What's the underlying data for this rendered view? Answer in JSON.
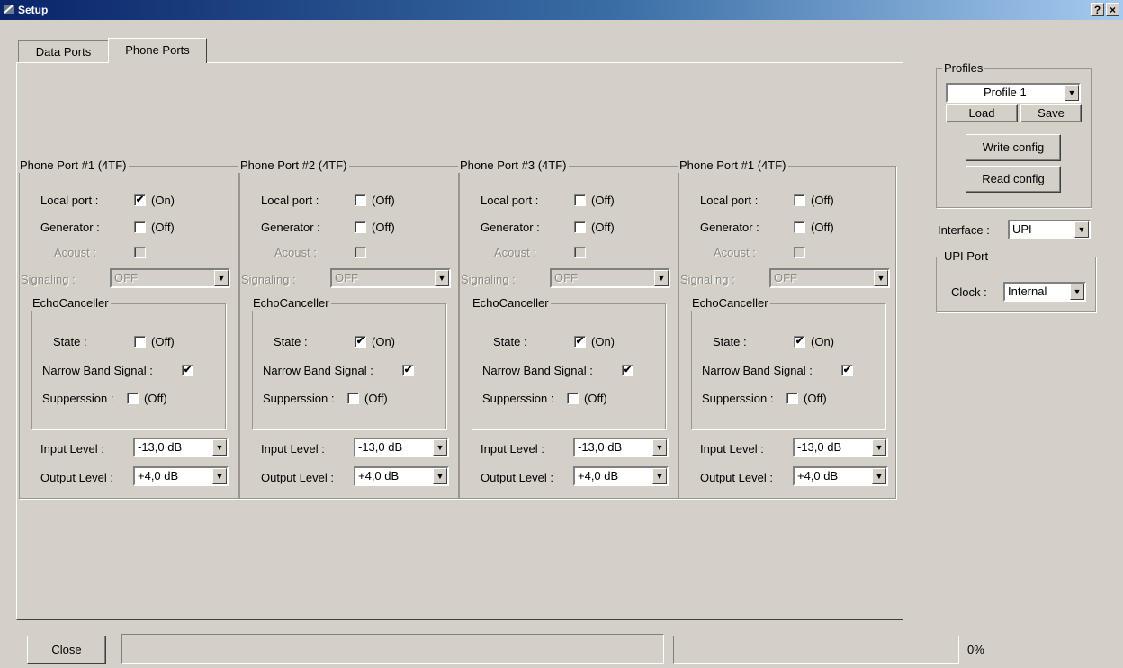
{
  "window": {
    "title": "Setup",
    "help_label": "?",
    "close_label": "×"
  },
  "tabs": [
    {
      "label": "Data Ports",
      "active": false
    },
    {
      "label": "Phone Ports",
      "active": true
    }
  ],
  "labels": {
    "local_port": "Local port :",
    "generator": "Generator :",
    "acoust": "Acoust :",
    "signaling": "Signaling :",
    "echo_canceller": "EchoCanceller",
    "state": "State :",
    "narrow_band": "Narrow Band Signal :",
    "suppression": "Supperssion :",
    "input_level": "Input Level :",
    "output_level": "Output Level :"
  },
  "ports": [
    {
      "title": "Phone Port #1 (4TF)",
      "local_port": {
        "checked": true,
        "text": "(On)"
      },
      "generator": {
        "checked": false,
        "text": "(Off)"
      },
      "acoust": false,
      "signaling": "OFF",
      "state": {
        "checked": false,
        "text": "(Off)"
      },
      "narrow_band": true,
      "suppression": {
        "checked": false,
        "text": "(Off)"
      },
      "input_level": "-13,0 dB",
      "output_level": "+4,0 dB"
    },
    {
      "title": "Phone Port #2 (4TF)",
      "local_port": {
        "checked": false,
        "text": "(Off)"
      },
      "generator": {
        "checked": false,
        "text": "(Off)"
      },
      "acoust": false,
      "signaling": "OFF",
      "state": {
        "checked": true,
        "text": "(On)"
      },
      "narrow_band": true,
      "suppression": {
        "checked": false,
        "text": "(Off)"
      },
      "input_level": "-13,0 dB",
      "output_level": "+4,0 dB"
    },
    {
      "title": "Phone Port #3 (4TF)",
      "local_port": {
        "checked": false,
        "text": "(Off)"
      },
      "generator": {
        "checked": false,
        "text": "(Off)"
      },
      "acoust": false,
      "signaling": "OFF",
      "state": {
        "checked": true,
        "text": "(On)"
      },
      "narrow_band": true,
      "suppression": {
        "checked": false,
        "text": "(Off)"
      },
      "input_level": "-13,0 dB",
      "output_level": "+4,0 dB"
    },
    {
      "title": "Phone Port #1 (4TF)",
      "local_port": {
        "checked": false,
        "text": "(Off)"
      },
      "generator": {
        "checked": false,
        "text": "(Off)"
      },
      "acoust": false,
      "signaling": "OFF",
      "state": {
        "checked": true,
        "text": "(On)"
      },
      "narrow_band": true,
      "suppression": {
        "checked": false,
        "text": "(Off)"
      },
      "input_level": "-13,0 dB",
      "output_level": "+4,0 dB"
    }
  ],
  "profiles": {
    "legend": "Profiles",
    "selected": "Profile 1",
    "load_label": "Load",
    "save_label": "Save",
    "write_config_label": "Write config",
    "read_config_label": "Read config"
  },
  "interface": {
    "label": "Interface :",
    "value": "UPI"
  },
  "upi_port": {
    "legend": "UPI Port",
    "clock_label": "Clock :",
    "clock_value": "Internal"
  },
  "footer": {
    "close_label": "Close",
    "status_text": "",
    "progress_percent": 0,
    "progress_label": "0%"
  },
  "icons": {
    "checked": "✔",
    "dropdown": "▼"
  }
}
